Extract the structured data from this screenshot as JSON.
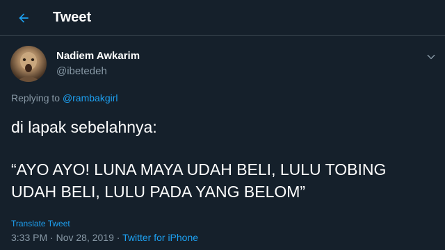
{
  "header": {
    "back_icon": "arrow-left-icon",
    "title": "Tweet"
  },
  "tweet": {
    "author": {
      "name": "Nadiem Awkarim",
      "handle": "@ibetedeh"
    },
    "menu_icon": "chevron-down-icon",
    "replying_prefix": "Replying to",
    "replying_to": "@rambakgirl",
    "text_line1": "di lapak sebelahnya:",
    "text_quote": "“AYO AYO! LUNA MAYA UDAH BELI, LULU TOBING UDAH BELI, LULU PADA YANG BELOM”",
    "translate_label": "Translate Tweet",
    "time": "3:33 PM",
    "date": "Nov 28, 2019",
    "separator": "·",
    "source": "Twitter for iPhone"
  },
  "colors": {
    "background": "#15202b",
    "accent": "#1da1f2",
    "secondary_text": "#8899a6",
    "divider": "#38444d"
  }
}
